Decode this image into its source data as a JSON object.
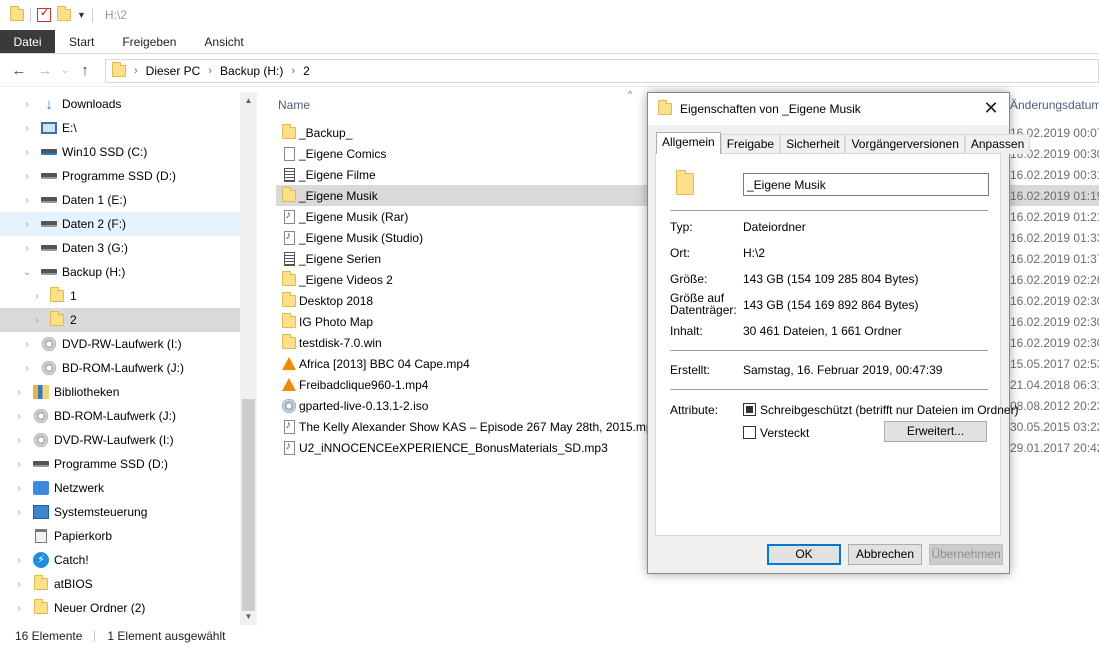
{
  "titlebar": {
    "path": "H:\\2"
  },
  "ribbon": {
    "tabs": [
      "Datei",
      "Start",
      "Freigeben",
      "Ansicht"
    ]
  },
  "address": {
    "crumbs": [
      "Dieser PC",
      "Backup (H:)",
      "2"
    ]
  },
  "sidebar": {
    "items": [
      {
        "label": "Downloads",
        "icon": "download-arrow-icon"
      },
      {
        "label": "E:\\",
        "icon": "drive-icon"
      },
      {
        "label": "Win10 SSD (C:)",
        "icon": "windows-drive-icon"
      },
      {
        "label": "Programme SSD (D:)",
        "icon": "drive-icon"
      },
      {
        "label": "Daten 1 (E:)",
        "icon": "drive-icon"
      },
      {
        "label": "Daten 2 (F:)",
        "icon": "drive-icon"
      },
      {
        "label": "Daten 3 (G:)",
        "icon": "drive-icon"
      },
      {
        "label": "Backup (H:)",
        "icon": "drive-icon"
      },
      {
        "label": "1",
        "icon": "folder-icon"
      },
      {
        "label": "2",
        "icon": "folder-icon"
      },
      {
        "label": "DVD-RW-Laufwerk (I:)",
        "icon": "disc-drive-icon"
      },
      {
        "label": "BD-ROM-Laufwerk (J:)",
        "icon": "disc-drive-icon"
      },
      {
        "label": "Bibliotheken",
        "icon": "libraries-icon"
      },
      {
        "label": "BD-ROM-Laufwerk (J:)",
        "icon": "disc-drive-icon"
      },
      {
        "label": "DVD-RW-Laufwerk (I:)",
        "icon": "disc-drive-icon"
      },
      {
        "label": "Programme SSD (D:)",
        "icon": "drive-icon"
      },
      {
        "label": "Netzwerk",
        "icon": "network-icon"
      },
      {
        "label": "Systemsteuerung",
        "icon": "control-panel-icon"
      },
      {
        "label": "Papierkorb",
        "icon": "recycle-bin-icon"
      },
      {
        "label": "Catch!",
        "icon": "catch-icon"
      },
      {
        "label": "atBIOS",
        "icon": "folder-icon"
      },
      {
        "label": "Neuer Ordner (2)",
        "icon": "folder-icon"
      }
    ]
  },
  "list": {
    "col_name": "Name",
    "col_date": "Änderungsdatum",
    "rows": [
      {
        "name": "_Backup_",
        "date": "16.02.2019 00:07",
        "icon": "folder-icon"
      },
      {
        "name": "_Eigene Comics",
        "date": "16.02.2019 00:30",
        "icon": "document-icon"
      },
      {
        "name": "_Eigene Filme",
        "date": "16.02.2019 00:31",
        "icon": "text-file-icon"
      },
      {
        "name": "_Eigene Musik",
        "date": "16.02.2019 01:19",
        "icon": "folder-icon"
      },
      {
        "name": "_Eigene Musik (Rar)",
        "date": "16.02.2019 01:21",
        "icon": "music-file-icon"
      },
      {
        "name": "_Eigene Musik (Studio)",
        "date": "16.02.2019 01:33",
        "icon": "music-file-icon"
      },
      {
        "name": "_Eigene Serien",
        "date": "16.02.2019 01:37",
        "icon": "text-file-icon"
      },
      {
        "name": "_Eigene Videos 2",
        "date": "16.02.2019 02:26",
        "icon": "folder-icon"
      },
      {
        "name": "Desktop 2018",
        "date": "16.02.2019 02:30",
        "icon": "folder-icon"
      },
      {
        "name": "IG Photo Map",
        "date": "16.02.2019 02:30",
        "icon": "folder-icon"
      },
      {
        "name": "testdisk-7.0.win",
        "date": "16.02.2019 02:30",
        "icon": "folder-icon"
      },
      {
        "name": "Africa [2013] BBC 04 Cape.mp4",
        "date": "15.05.2017 02:53",
        "icon": "vlc-icon"
      },
      {
        "name": "Freibadclique960-1.mp4",
        "date": "21.04.2018 06:31",
        "icon": "vlc-icon"
      },
      {
        "name": "gparted-live-0.13.1-2.iso",
        "date": "08.08.2012 20:23",
        "icon": "disc-image-icon"
      },
      {
        "name": "The Kelly Alexander Show KAS – Episode 267 May 28th, 2015.mp3",
        "date": "30.05.2015 03:22",
        "icon": "music-file-icon"
      },
      {
        "name": "U2_iNNOCENCEeXPERIENCE_BonusMaterials_SD.mp3",
        "date": "29.01.2017 20:42",
        "icon": "music-file-icon"
      }
    ]
  },
  "status": {
    "count": "16 Elemente",
    "selected": "1 Element ausgewählt"
  },
  "dialog": {
    "title": "Eigenschaften von _Eigene Musik",
    "tabs": [
      "Allgemein",
      "Freigabe",
      "Sicherheit",
      "Vorgängerversionen",
      "Anpassen"
    ],
    "name_value": "_Eigene Musik",
    "typ_label": "Typ:",
    "typ_value": "Dateiordner",
    "ort_label": "Ort:",
    "ort_value": "H:\\2",
    "groesse_label": "Größe:",
    "groesse_value": "143 GB (154 109 285 804 Bytes)",
    "groesse_dt_label_1": "Größe auf",
    "groesse_dt_label_2": "Datenträger:",
    "groesse_dt_value": "143 GB (154 169 892 864 Bytes)",
    "inhalt_label": "Inhalt:",
    "inhalt_value": "30 461 Dateien, 1 661 Ordner",
    "erstellt_label": "Erstellt:",
    "erstellt_value": "Samstag, 16. Februar 2019, 00:47:39",
    "attribute_label": "Attribute:",
    "readonly_label": "Schreibgeschützt (betrifft nur Dateien im Ordner)",
    "hidden_label": "Versteckt",
    "advanced_button": "Erweitert...",
    "ok_button": "OK",
    "cancel_button": "Abbrechen",
    "apply_button": "Übernehmen"
  }
}
